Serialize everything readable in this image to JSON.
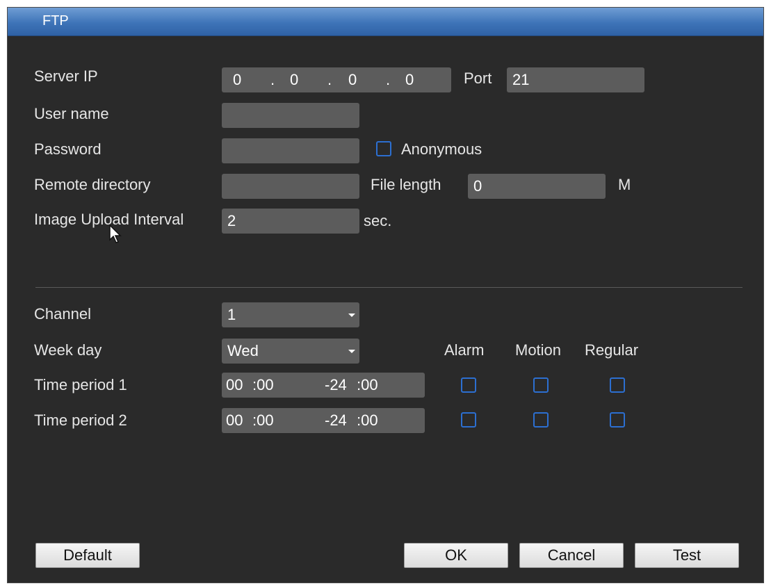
{
  "window": {
    "title": "FTP"
  },
  "server": {
    "server_ip_label": "Server IP",
    "ip_octets": [
      "0",
      "0",
      "0",
      "0"
    ],
    "ip_separator": ".",
    "port_label": "Port",
    "port_value": "21",
    "user_name_label": "User name",
    "user_name_value": "",
    "password_label": "Password",
    "password_value": "",
    "anonymous_label": "Anonymous",
    "anonymous_checked": false,
    "remote_directory_label": "Remote directory",
    "remote_directory_value": "",
    "file_length_label": "File length",
    "file_length_value": "0",
    "file_length_unit": "M",
    "upload_interval_label": "Image Upload Interval",
    "upload_interval_value": "2",
    "upload_interval_unit": "sec."
  },
  "schedule": {
    "channel_label": "Channel",
    "channel_value": "1",
    "week_day_label": "Week day",
    "week_day_value": "Wed",
    "col_alarm": "Alarm",
    "col_motion": "Motion",
    "col_regular": "Regular",
    "periods": [
      {
        "label": "Time period 1",
        "start_h": "00",
        "start_m": ":00",
        "end_h": "-24",
        "end_m": ":00"
      },
      {
        "label": "Time period 2",
        "start_h": "00",
        "start_m": ":00",
        "end_h": "-24",
        "end_m": ":00"
      }
    ]
  },
  "buttons": {
    "default": "Default",
    "ok": "OK",
    "cancel": "Cancel",
    "test": "Test"
  },
  "colors": {
    "title_bar": "#3e74b8",
    "panel_bg": "#2a2a2a",
    "field_bg": "#5c5c5c",
    "checkbox_border": "#2c6fd1"
  },
  "icons": {
    "cursor": "mouse-pointer-icon",
    "dropdown": "chevron-down-icon"
  }
}
